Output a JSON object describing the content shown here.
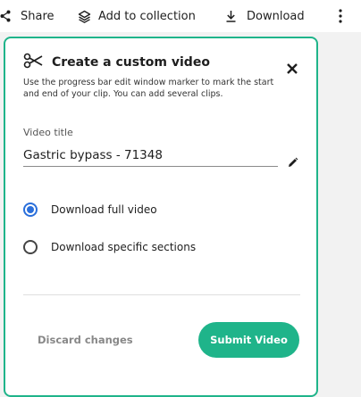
{
  "toolbar": {
    "share": {
      "label": "Share",
      "icon": "share-icon"
    },
    "collection": {
      "label": "Add to collection",
      "icon": "layers-icon"
    },
    "download": {
      "label": "Download",
      "icon": "download-icon"
    },
    "more": {
      "icon": "more-vertical-icon"
    }
  },
  "panel": {
    "title": "Create a custom video",
    "description": "Use the progress bar edit window marker to mark the start and end of your clip. You can add several clips.",
    "video_title_label": "Video title",
    "video_title_value": "Gastric bypass - 71348",
    "options": [
      {
        "label": "Download full video",
        "selected": true
      },
      {
        "label": "Download specific sections",
        "selected": false
      }
    ],
    "discard_label": "Discard changes",
    "submit_label": "Submit Video"
  },
  "colors": {
    "accent": "#1fb48a",
    "radio_selected": "#2a6fdb",
    "muted_text": "#888888"
  }
}
